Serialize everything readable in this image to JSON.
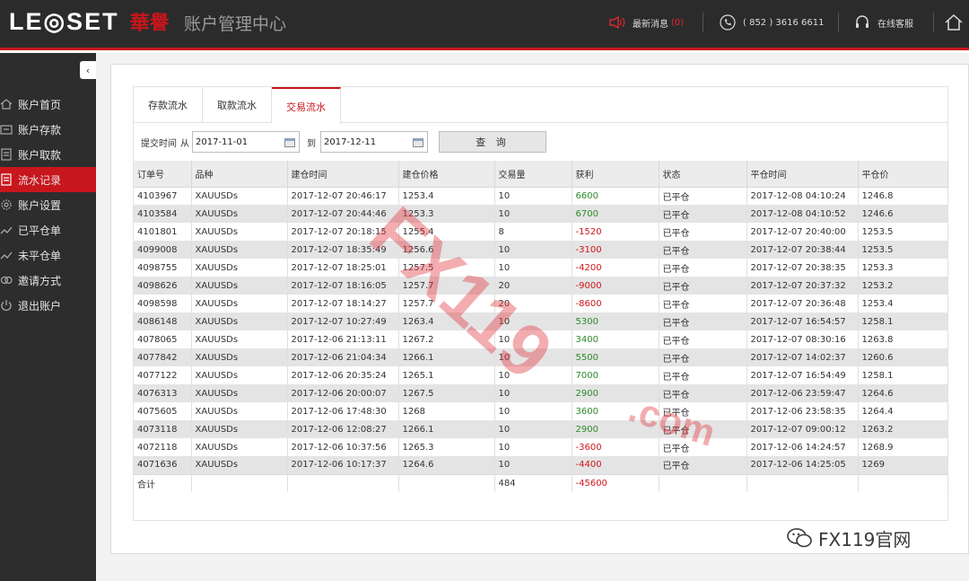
{
  "header": {
    "logo_text": "LE◎SET",
    "logo_cn": "華譽",
    "title": "账户管理中心",
    "news_label": "最新消息",
    "news_count": "(0)",
    "phone": "( 852 ) 3616 6611",
    "service_label": "在线客服"
  },
  "sidebar": {
    "collapse_icon": "‹",
    "items": [
      {
        "label": "账户首页",
        "icon": "home-icon"
      },
      {
        "label": "账户存款",
        "icon": "deposit-icon"
      },
      {
        "label": "账户取款",
        "icon": "withdraw-icon"
      },
      {
        "label": "流水记录",
        "icon": "record-icon",
        "active": true
      },
      {
        "label": "账户设置",
        "icon": "gear-icon"
      },
      {
        "label": "已平仓单",
        "icon": "closed-orders-icon"
      },
      {
        "label": "未平仓单",
        "icon": "open-orders-icon"
      },
      {
        "label": "邀请方式",
        "icon": "invite-icon"
      },
      {
        "label": "退出账户",
        "icon": "power-icon"
      }
    ]
  },
  "tabs": [
    {
      "label": "存款流水"
    },
    {
      "label": "取款流水"
    },
    {
      "label": "交易流水",
      "active": true
    }
  ],
  "filter": {
    "label_time": "提交时间",
    "label_from": "从",
    "from_date": "2017-11-01",
    "label_to": "到",
    "to_date": "2017-12-11",
    "query_button": "查 询"
  },
  "table": {
    "columns": [
      "订单号",
      "品种",
      "建仓时间",
      "建仓价格",
      "交易量",
      "获利",
      "状态",
      "平仓时间",
      "平仓价"
    ],
    "rows": [
      [
        "4103967",
        "XAUUSDs",
        "2017-12-07 20:46:17",
        "1253.4",
        "10",
        "6600",
        "已平仓",
        "2017-12-08 04:10:24",
        "1246.8"
      ],
      [
        "4103584",
        "XAUUSDs",
        "2017-12-07 20:44:46",
        "1253.3",
        "10",
        "6700",
        "已平仓",
        "2017-12-08 04:10:52",
        "1246.6"
      ],
      [
        "4101801",
        "XAUUSDs",
        "2017-12-07 20:18:15",
        "1255.4",
        "8",
        "-1520",
        "已平仓",
        "2017-12-07 20:40:00",
        "1253.5"
      ],
      [
        "4099008",
        "XAUUSDs",
        "2017-12-07 18:35:49",
        "1256.6",
        "10",
        "-3100",
        "已平仓",
        "2017-12-07 20:38:44",
        "1253.5"
      ],
      [
        "4098755",
        "XAUUSDs",
        "2017-12-07 18:25:01",
        "1257.5",
        "10",
        "-4200",
        "已平仓",
        "2017-12-07 20:38:35",
        "1253.3"
      ],
      [
        "4098626",
        "XAUUSDs",
        "2017-12-07 18:16:05",
        "1257.7",
        "20",
        "-9000",
        "已平仓",
        "2017-12-07 20:37:32",
        "1253.2"
      ],
      [
        "4098598",
        "XAUUSDs",
        "2017-12-07 18:14:27",
        "1257.7",
        "20",
        "-8600",
        "已平仓",
        "2017-12-07 20:36:48",
        "1253.4"
      ],
      [
        "4086148",
        "XAUUSDs",
        "2017-12-07 10:27:49",
        "1263.4",
        "10",
        "5300",
        "已平仓",
        "2017-12-07 16:54:57",
        "1258.1"
      ],
      [
        "4078065",
        "XAUUSDs",
        "2017-12-06 21:13:11",
        "1267.2",
        "10",
        "3400",
        "已平仓",
        "2017-12-07 08:30:16",
        "1263.8"
      ],
      [
        "4077842",
        "XAUUSDs",
        "2017-12-06 21:04:34",
        "1266.1",
        "10",
        "5500",
        "已平仓",
        "2017-12-07 14:02:37",
        "1260.6"
      ],
      [
        "4077122",
        "XAUUSDs",
        "2017-12-06 20:35:24",
        "1265.1",
        "10",
        "7000",
        "已平仓",
        "2017-12-07 16:54:49",
        "1258.1"
      ],
      [
        "4076313",
        "XAUUSDs",
        "2017-12-06 20:00:07",
        "1267.5",
        "10",
        "2900",
        "已平仓",
        "2017-12-06 23:59:47",
        "1264.6"
      ],
      [
        "4075605",
        "XAUUSDs",
        "2017-12-06 17:48:30",
        "1268",
        "10",
        "3600",
        "已平仓",
        "2017-12-06 23:58:35",
        "1264.4"
      ],
      [
        "4073118",
        "XAUUSDs",
        "2017-12-06 12:08:27",
        "1266.1",
        "10",
        "2900",
        "已平仓",
        "2017-12-07 09:00:12",
        "1263.2"
      ],
      [
        "4072118",
        "XAUUSDs",
        "2017-12-06 10:37:56",
        "1265.3",
        "10",
        "-3600",
        "已平仓",
        "2017-12-06 14:24:57",
        "1268.9"
      ],
      [
        "4071636",
        "XAUUSDs",
        "2017-12-06 10:17:37",
        "1264.6",
        "10",
        "-4400",
        "已平仓",
        "2017-12-06 14:25:05",
        "1269"
      ]
    ],
    "total": {
      "label": "合计",
      "volume": "484",
      "profit": "-45600"
    }
  },
  "watermark": {
    "main": "FX119",
    "sub": ".com"
  },
  "wechat": {
    "label": "FX119官网"
  },
  "colors": {
    "brand_red": "#c8161d",
    "profit_green": "#2a8a2a",
    "loss_red": "#d0141b",
    "header_bg": "#2b2b2b",
    "sidebar_bg": "#2d2d2d"
  }
}
